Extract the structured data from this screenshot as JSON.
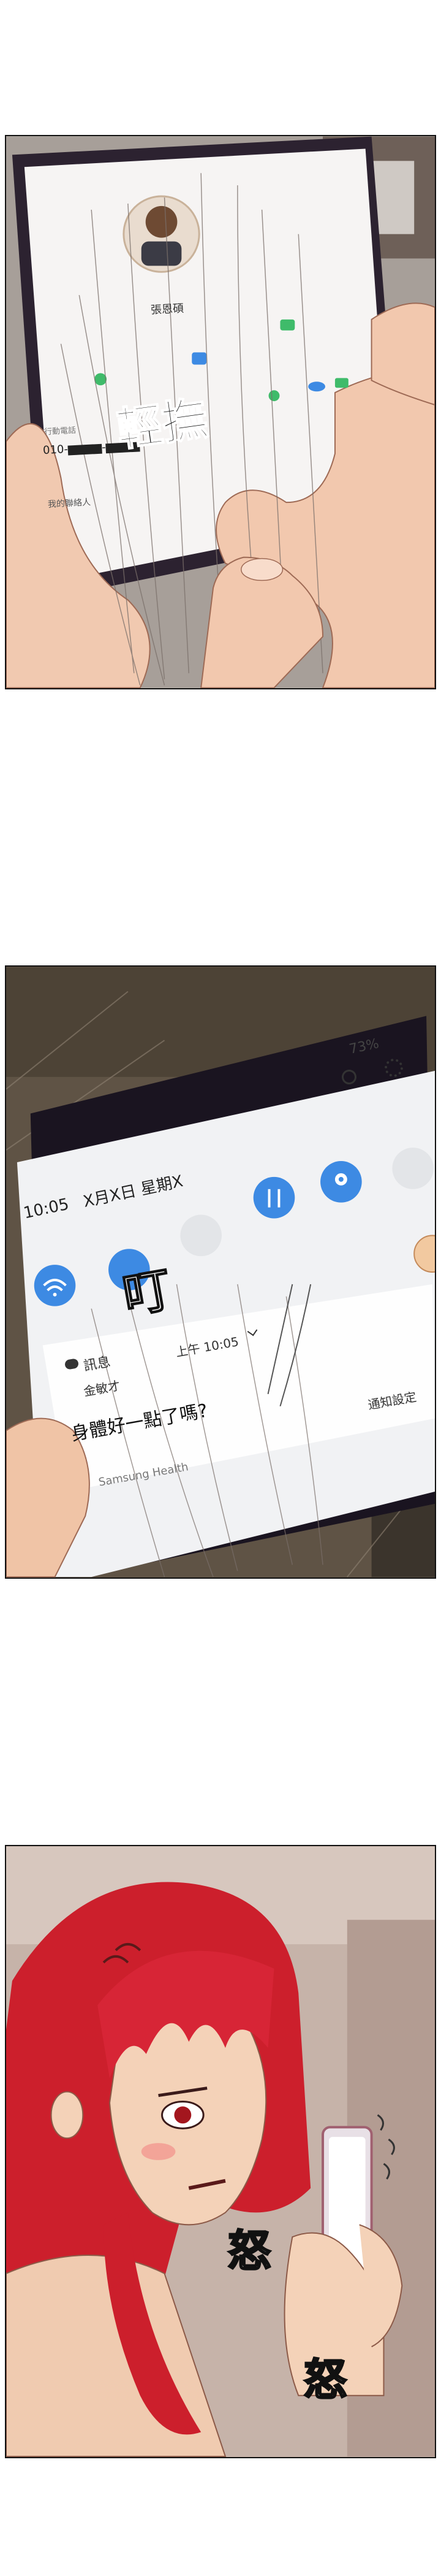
{
  "panel1": {
    "contact_name": "張恩碩",
    "phone_header": "行動電話",
    "phone_masked": "010-▆▆▆▆-▆▆▆▆",
    "relation_label": "我的聯絡人",
    "sfx": "輕撫"
  },
  "panel2": {
    "battery": "73%",
    "time": "10:05",
    "date": "X月X日 星期X",
    "sfx": "叮",
    "notif_app": "訊息",
    "notif_time": "上午 10:05",
    "notif_sender": "金敏才",
    "notif_message": "身體好一點了嗎?",
    "health_app": "Samsung Health",
    "settings_link": "通知設定",
    "colors": {
      "accent": "#3d8ae3",
      "panel_bg": "#6a5c4c"
    }
  },
  "panel3": {
    "sfx_1": "怒",
    "sfx_2": "怒",
    "colors": {
      "hair": "#cc1f2c",
      "skin": "#f4d2b8"
    }
  }
}
